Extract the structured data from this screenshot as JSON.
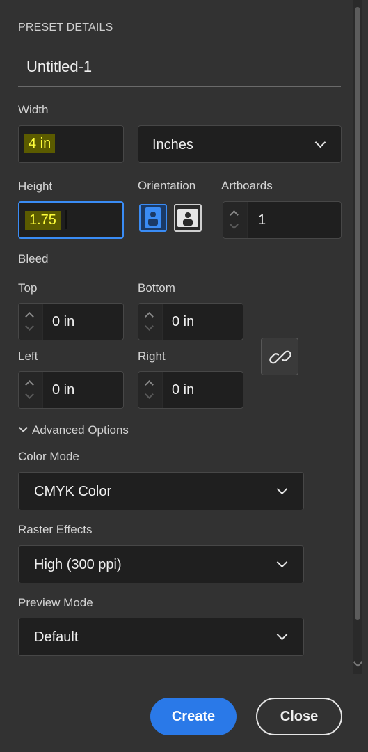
{
  "preset": {
    "section_title": "PRESET DETAILS",
    "name": "Untitled-1"
  },
  "width": {
    "label": "Width",
    "value": "4 in",
    "units": "Inches"
  },
  "height": {
    "label": "Height",
    "value": "1.75"
  },
  "orientation": {
    "label": "Orientation",
    "selected": "portrait"
  },
  "artboards": {
    "label": "Artboards",
    "value": "1"
  },
  "bleed": {
    "label": "Bleed",
    "top": {
      "label": "Top",
      "value": "0 in"
    },
    "bottom": {
      "label": "Bottom",
      "value": "0 in"
    },
    "left": {
      "label": "Left",
      "value": "0 in"
    },
    "right": {
      "label": "Right",
      "value": "0 in"
    }
  },
  "advanced": {
    "toggle_label": "Advanced Options",
    "color_mode": {
      "label": "Color Mode",
      "value": "CMYK Color"
    },
    "raster_effects": {
      "label": "Raster Effects",
      "value": "High (300 ppi)"
    },
    "preview_mode": {
      "label": "Preview Mode",
      "value": "Default"
    }
  },
  "buttons": {
    "create": "Create",
    "close": "Close"
  },
  "colors": {
    "accent": "#2a79e8",
    "highlight": "#f2f200",
    "panel": "#323232",
    "field": "#1f1f1f"
  }
}
